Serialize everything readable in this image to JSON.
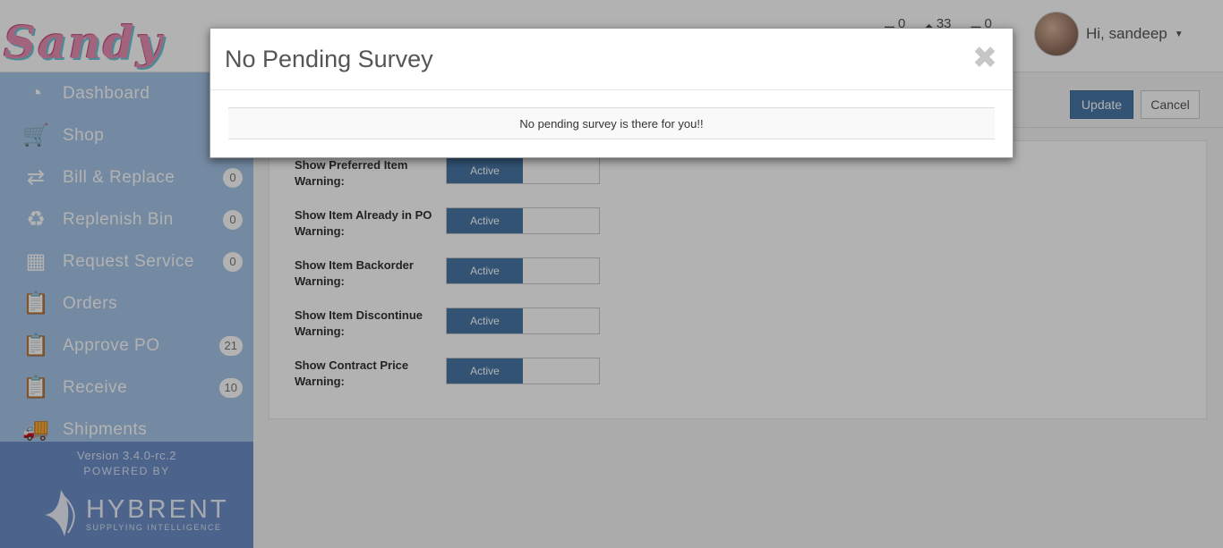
{
  "header": {
    "logo_text": "Sandy",
    "counters": [
      {
        "icon": "cart-icon",
        "glyph": "▬",
        "value": "0"
      },
      {
        "icon": "diamond-icon",
        "glyph": "◆",
        "value": "33"
      },
      {
        "icon": "flag-icon",
        "glyph": "▬",
        "value": "0"
      }
    ],
    "user_greeting": "Hi, sandeep"
  },
  "sidebar": {
    "items": [
      {
        "label": "Dashboard",
        "icon": "dashboard-icon",
        "glyph": "◔",
        "badge": ""
      },
      {
        "label": "Shop",
        "icon": "cart-icon",
        "glyph": "🛒",
        "badge": ""
      },
      {
        "label": "Bill & Replace",
        "icon": "replace-icon",
        "glyph": "⇄",
        "badge": "0"
      },
      {
        "label": "Replenish Bin",
        "icon": "recycle-bin-icon",
        "glyph": "♻",
        "badge": "0"
      },
      {
        "label": "Request Service",
        "icon": "service-cart-icon",
        "glyph": "▦",
        "badge": "0"
      },
      {
        "label": "Orders",
        "icon": "orders-icon",
        "glyph": "📋",
        "badge": ""
      },
      {
        "label": "Approve PO",
        "icon": "approve-icon",
        "glyph": "📋",
        "badge": "21"
      },
      {
        "label": "Receive",
        "icon": "receive-icon",
        "glyph": "📋",
        "badge": "10"
      },
      {
        "label": "Shipments",
        "icon": "truck-icon",
        "glyph": "🚚",
        "badge": ""
      }
    ],
    "version": "Version 3.4.0-rc.2",
    "powered_by": "POWERED BY",
    "brand_name": "HYBRENT",
    "brand_tagline": "SUPPLYING INTELLIGENCE"
  },
  "actions": {
    "update_label": "Update",
    "cancel_label": "Cancel"
  },
  "settings": [
    {
      "label": "Show Preferred Item Warning:",
      "value": "Active"
    },
    {
      "label": "Show Item Already in PO Warning:",
      "value": "Active"
    },
    {
      "label": "Show Item Backorder Warning:",
      "value": "Active"
    },
    {
      "label": "Show Item Discontinue Warning:",
      "value": "Active"
    },
    {
      "label": "Show Contract Price Warning:",
      "value": "Active"
    }
  ],
  "modal": {
    "title": "No Pending Survey",
    "close_glyph": "✖",
    "message": "No pending survey is there for you!!"
  }
}
